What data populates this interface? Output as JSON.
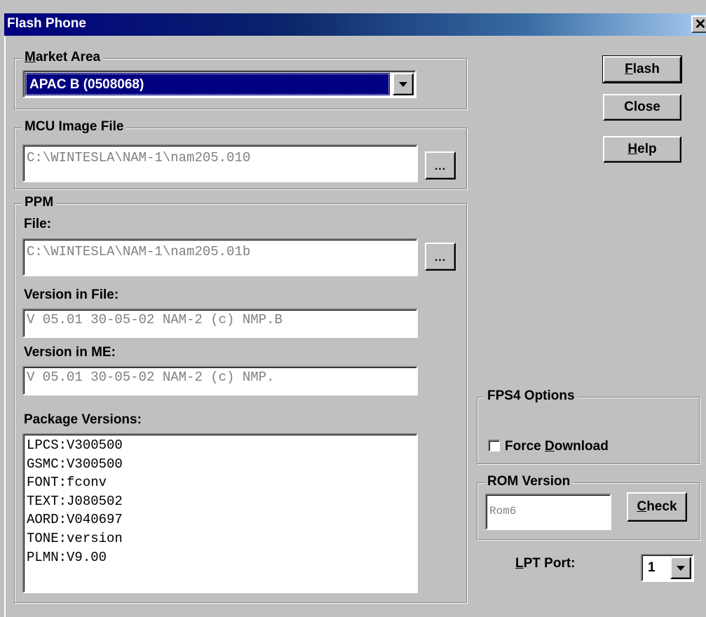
{
  "window": {
    "title": "Flash Phone"
  },
  "market_area": {
    "label_u": "M",
    "label_rest": "arket Area",
    "selected": "APAC B (0508068)"
  },
  "mcu_image": {
    "label": "MCU Image File",
    "path": "C:\\WINTESLA\\NAM-1\\nam205.010",
    "browse_label": "..."
  },
  "ppm": {
    "label": "PPM",
    "file_label": "File:",
    "file_path": "C:\\WINTESLA\\NAM-1\\nam205.01b",
    "browse_label": "...",
    "version_file_label": "Version in File:",
    "version_file": "V 05.01 30-05-02 NAM-2 (c) NMP.B",
    "version_me_label": "Version in ME:",
    "version_me": "V 05.01 30-05-02 NAM-2 (c) NMP.",
    "packages_label": "Package Versions:",
    "packages": [
      "LPCS:V300500",
      "GSMC:V300500",
      "FONT:fconv",
      "TEXT:J080502",
      "AORD:V040697",
      "TONE:version",
      "PLMN:V9.00"
    ]
  },
  "buttons": {
    "flash": {
      "u": "F",
      "rest": "lash"
    },
    "close": "Close",
    "help": {
      "u": "H",
      "rest": "elp"
    }
  },
  "fps4": {
    "label": "FPS4 Options",
    "force_pre": "Force ",
    "force_u": "D",
    "force_rest": "ownload",
    "checked": false
  },
  "rom": {
    "label": "ROM Version",
    "value": "Rom6",
    "check_u": "C",
    "check_rest": "heck"
  },
  "lpt": {
    "label_u": "L",
    "label_rest": "PT Port:",
    "value": "1"
  },
  "title_close_glyph": "✕"
}
